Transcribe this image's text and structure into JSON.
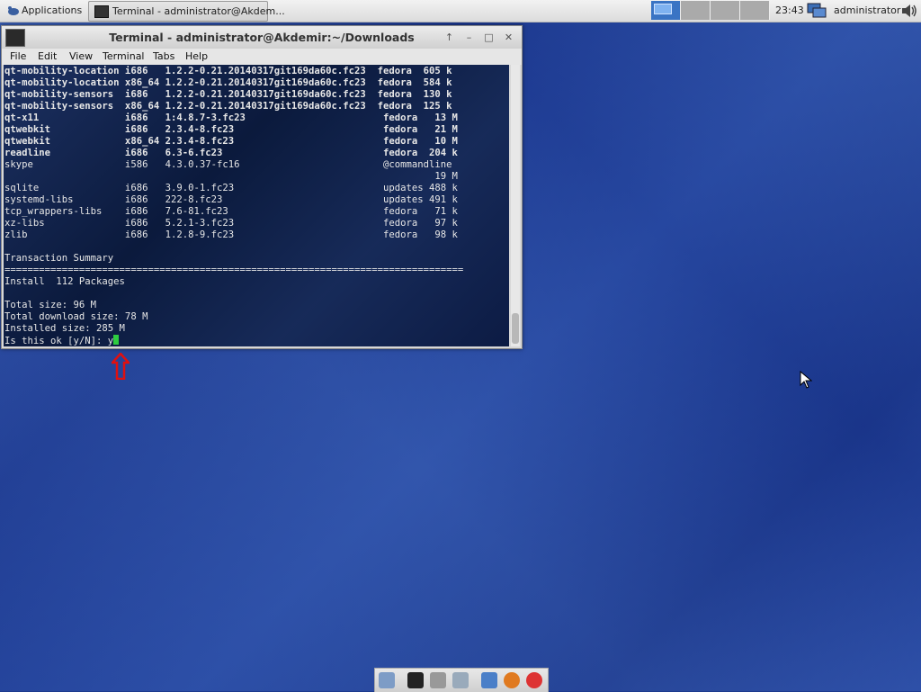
{
  "panel": {
    "apps_label": "Applications",
    "task_label": "Terminal - administrator@Akdem...",
    "clock": "23:43",
    "user": "administrator"
  },
  "window": {
    "title": "Terminal - administrator@Akdemir:~/Downloads",
    "menus": [
      "File",
      "Edit",
      "View",
      "Terminal",
      "Tabs",
      "Help"
    ]
  },
  "terminal": {
    "lines": [
      "qt-mobility-location i686   1.2.2-0.21.20140317git169da60c.fc23  fedora  605 k",
      "qt-mobility-location x86_64 1.2.2-0.21.20140317git169da60c.fc23  fedora  584 k",
      "qt-mobility-sensors  i686   1.2.2-0.21.20140317git169da60c.fc23  fedora  130 k",
      "qt-mobility-sensors  x86_64 1.2.2-0.21.20140317git169da60c.fc23  fedora  125 k",
      "qt-x11               i686   1:4.8.7-3.fc23                        fedora   13 M",
      "qtwebkit             i686   2.3.4-8.fc23                          fedora   21 M",
      "qtwebkit             x86_64 2.3.4-8.fc23                          fedora   10 M",
      "readline             i686   6.3-6.fc23                            fedora  204 k",
      "skype                i586   4.3.0.37-fc16                         @commandline",
      "                                                                           19 M",
      "sqlite               i686   3.9.0-1.fc23                          updates 488 k",
      "systemd-libs         i686   222-8.fc23                            updates 491 k",
      "tcp_wrappers-libs    i686   7.6-81.fc23                           fedora   71 k",
      "xz-libs              i686   5.2.1-3.fc23                          fedora   97 k",
      "zlib                 i686   1.2.8-9.fc23                          fedora   98 k",
      "",
      "Transaction Summary",
      "================================================================================",
      "Install  112 Packages",
      "",
      "Total size: 96 M",
      "Total download size: 78 M",
      "Installed size: 285 M",
      "Is this ok [y/N]: y"
    ]
  },
  "colors": {
    "cursor": "#2ecc40",
    "arrow": "#e01010",
    "workspace_active": "#3a74c4"
  }
}
